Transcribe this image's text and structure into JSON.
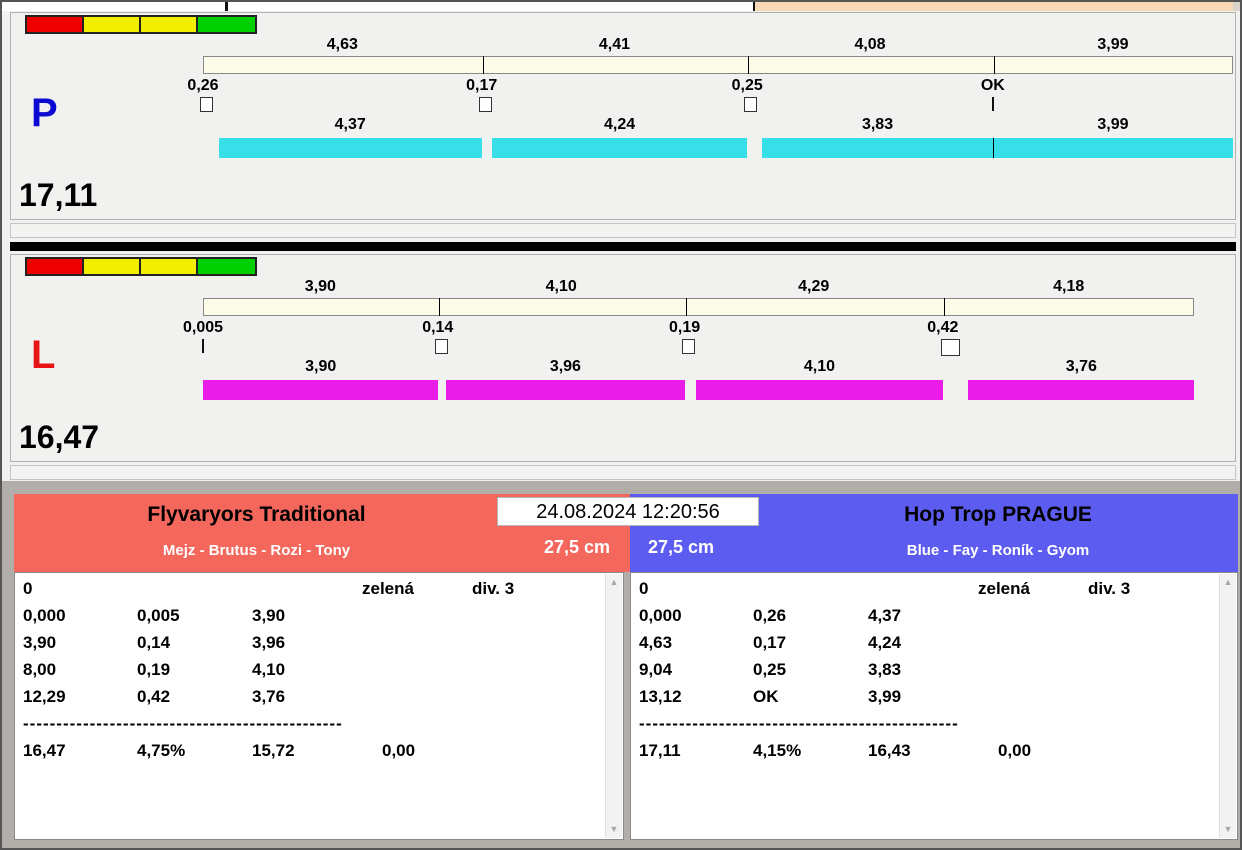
{
  "timestamp": "24.08.2024 12:20:56",
  "traffic_lights": [
    {
      "name": "red",
      "color": "#ee0000"
    },
    {
      "name": "yellow",
      "color": "#f2ee00"
    },
    {
      "name": "yellow",
      "color": "#f2ee00"
    },
    {
      "name": "green",
      "color": "#00cf00"
    }
  ],
  "top_strip": {
    "peach_color": "#f7d9b6"
  },
  "lanes": [
    {
      "letter": "P",
      "letter_color": "#0a0ad2",
      "total_label": "17,11",
      "bar_color": "#38dfe8",
      "top": {
        "labels": [
          "4,63",
          "4,41",
          "4,08",
          "3,99"
        ],
        "values": [
          4.63,
          4.41,
          4.08,
          3.99
        ]
      },
      "crossings": [
        {
          "label": "0,26",
          "delay": 0.26,
          "marker": "box"
        },
        {
          "label": "0,17",
          "delay": 0.17,
          "marker": "box"
        },
        {
          "label": "0,25",
          "delay": 0.25,
          "marker": "box"
        },
        {
          "label": "OK",
          "delay": 0,
          "marker": "tick"
        }
      ],
      "bottom": {
        "labels": [
          "4,37",
          "4,24",
          "3,83",
          "3,99"
        ],
        "values": [
          4.37,
          4.24,
          3.83,
          3.99
        ]
      }
    },
    {
      "letter": "L",
      "letter_color": "#e61414",
      "total_label": "16,47",
      "bar_color": "#ea1de8",
      "top": {
        "labels": [
          "3,90",
          "4,10",
          "4,29",
          "4,18"
        ],
        "values": [
          3.9,
          4.1,
          4.29,
          4.18
        ]
      },
      "crossings": [
        {
          "label": "0,005",
          "delay": 0.005,
          "marker": "tick"
        },
        {
          "label": "0,14",
          "delay": 0.14,
          "marker": "box"
        },
        {
          "label": "0,19",
          "delay": 0.19,
          "marker": "box"
        },
        {
          "label": "0,42",
          "delay": 0.42,
          "marker": "box-large"
        }
      ],
      "bottom": {
        "labels": [
          "3,90",
          "3,96",
          "4,10",
          "3,76"
        ],
        "values": [
          3.9,
          3.96,
          4.1,
          3.76
        ]
      }
    }
  ],
  "teams": [
    {
      "name": "Flyvaryors Traditional",
      "members": "Mejz - Brutus - Rozi - Tony",
      "size_label": "27,5 cm",
      "header_color": "#f4675d",
      "log": {
        "status": "0",
        "color_word": "zelená",
        "division": "div. 3",
        "rows": [
          [
            "0,000",
            "0,005",
            "3,90"
          ],
          [
            "3,90",
            "0,14",
            "3,96"
          ],
          [
            "8,00",
            "0,19",
            "4,10"
          ],
          [
            "12,29",
            "0,42",
            "3,76"
          ]
        ],
        "divider": "------------------------------------------------",
        "totals": [
          "16,47",
          "4,75%",
          "15,72",
          "0,00"
        ]
      }
    },
    {
      "name": "Hop Trop PRAGUE",
      "members": "Blue - Fay - Roník - Gyom",
      "size_label": "27,5 cm",
      "header_color": "#5c5cf0",
      "log": {
        "status": "0",
        "color_word": "zelená",
        "division": "div. 3",
        "rows": [
          [
            "0,000",
            "0,26",
            "4,37"
          ],
          [
            "4,63",
            "0,17",
            "4,24"
          ],
          [
            "9,04",
            "0,25",
            "3,83"
          ],
          [
            "13,12",
            "OK",
            "3,99"
          ]
        ],
        "divider": "------------------------------------------------",
        "totals": [
          "17,11",
          "4,15%",
          "16,43",
          "0,00"
        ]
      }
    }
  ]
}
